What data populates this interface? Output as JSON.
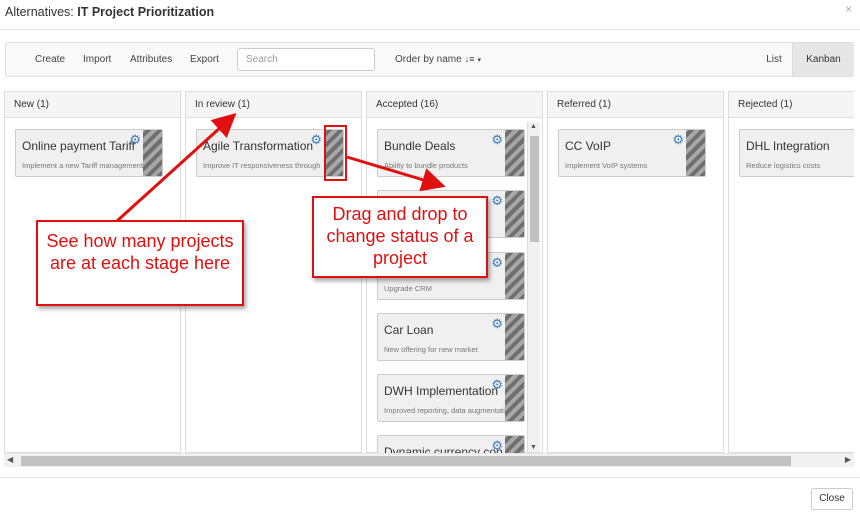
{
  "window": {
    "title_prefix": "Alternatives: ",
    "title_name": "IT Project Prioritization",
    "close_icon": "×"
  },
  "toolbar": {
    "create": "Create",
    "import": "Import",
    "attributes": "Attributes",
    "export": "Export",
    "search_placeholder": "Search",
    "order_label": "Order by name",
    "order_icon": "↓≡",
    "order_caret": "▾",
    "view_list": "List",
    "view_kanban": "Kanban"
  },
  "columns": [
    {
      "header": "New (1)",
      "cards": [
        {
          "title": "Online payment Tariff",
          "desc": "Implement a new Tariff management"
        }
      ]
    },
    {
      "header": "In review (1)",
      "cards": [
        {
          "title": "Agile Transformation",
          "desc": "Improve IT responsiveness through"
        }
      ]
    },
    {
      "header": "Accepted (16)",
      "cards": [
        {
          "title": "Bundle Deals",
          "desc": "Ability to bundle products"
        },
        {
          "title": "",
          "desc": ""
        },
        {
          "title": "",
          "desc": "Upgrade CRM"
        },
        {
          "title": "Car Loan",
          "desc": "New offering for new market"
        },
        {
          "title": "DWH Implementation",
          "desc": "Improved reporting, data augmentation"
        },
        {
          "title": "Dynamic currency con",
          "desc": ""
        }
      ]
    },
    {
      "header": "Referred (1)",
      "cards": [
        {
          "title": "CC VoIP",
          "desc": "Implement VoIP systems"
        }
      ]
    },
    {
      "header": "Rejected (1)",
      "cards": [
        {
          "title": "DHL Integration",
          "desc": "Reduce logistics costs"
        }
      ]
    }
  ],
  "icons": {
    "gear": "⚙",
    "scroll_up": "▲",
    "scroll_down": "▼",
    "scroll_left": "◀",
    "scroll_right": "▶"
  },
  "footer": {
    "close_label": "Close"
  },
  "annotations": {
    "callout_1": "See how many projects are at each stage here",
    "callout_2": "Drag and drop to change status of a project"
  },
  "colors": {
    "annotation_red": "#e01010",
    "gear_blue": "#3a7bbf"
  }
}
